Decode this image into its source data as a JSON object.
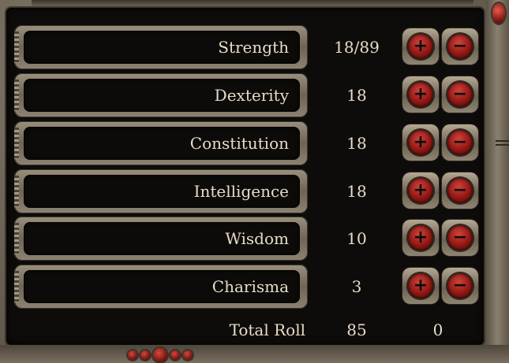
{
  "stats": [
    {
      "name": "Strength",
      "value": "18/89"
    },
    {
      "name": "Dexterity",
      "value": "18"
    },
    {
      "name": "Constitution",
      "value": "18"
    },
    {
      "name": "Intelligence",
      "value": "18"
    },
    {
      "name": "Wisdom",
      "value": "10"
    },
    {
      "name": "Charisma",
      "value": "3"
    }
  ],
  "buttons": {
    "plus_glyph": "+",
    "minus_glyph": "−"
  },
  "total": {
    "label": "Total Roll",
    "value": "85",
    "points_remaining": "0"
  },
  "colors": {
    "text": "#e8dcc6",
    "panel": "#0e0c0b",
    "gem_red": "#8d1712",
    "stone": "#6e6555"
  }
}
